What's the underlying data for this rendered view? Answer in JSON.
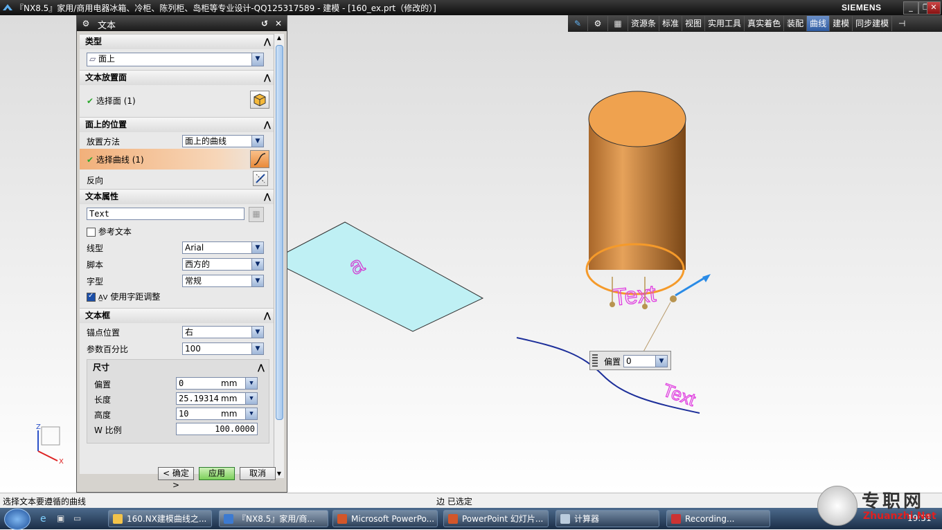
{
  "window": {
    "title": "『NX8.5』家用/商用电器冰箱、冷柜、陈列柜、岛柜等专业设计-QQ125317589 - 建模 - [160_ex.prt（修改的）]",
    "brand": "SIEMENS"
  },
  "toolbar": {
    "tabs": [
      "资源条",
      "标准",
      "视图",
      "实用工具",
      "真实着色",
      "装配",
      "曲线",
      "建模",
      "同步建模"
    ],
    "active": "曲线"
  },
  "dialog": {
    "title": "文本",
    "sections": {
      "type": {
        "header": "类型",
        "value": "面上"
      },
      "placement_face": {
        "header": "文本放置面",
        "select_face": "选择面 (1)"
      },
      "face_position": {
        "header": "面上的位置",
        "method_label": "放置方法",
        "method_value": "面上的曲线",
        "select_curve": "选择曲线 (1)",
        "reverse_label": "反向"
      },
      "text_props": {
        "header": "文本属性",
        "text_value": "Text",
        "ref_text_label": "参考文本",
        "font_label": "线型",
        "font_value": "Arial",
        "script_label": "脚本",
        "script_value": "西方的",
        "style_label": "字型",
        "style_value": "常规",
        "kerning_label": "使用字距调整"
      },
      "text_box": {
        "header": "文本框",
        "anchor_label": "锚点位置",
        "anchor_value": "右",
        "param_label": "参数百分比",
        "param_value": "100",
        "dims_header": "尺寸",
        "offset_label": "偏置",
        "offset_value": "0",
        "length_label": "长度",
        "length_value": "25.19314",
        "height_label": "高度",
        "height_value": "10",
        "unit": "mm",
        "wscale_label": "W 比例",
        "wscale_value": "100.0000"
      }
    },
    "buttons": {
      "ok": "< 确定 >",
      "apply": "应用",
      "cancel": "取消"
    }
  },
  "viewport": {
    "plane_text": "a",
    "cyl_text": "Text",
    "curve_text": "Text",
    "popup_label": "偏置",
    "popup_value": "0",
    "axis_z": "Z",
    "axis_x": "X"
  },
  "status": {
    "left": "选择文本要遵循的曲线",
    "right": "边 已选定"
  },
  "taskbar": {
    "items": [
      "160.NX建模曲线之...",
      "『NX8.5』家用/商...",
      "Microsoft PowerPo...",
      "PowerPoint 幻灯片...",
      "计算器",
      "Recording..."
    ],
    "clock": "19:51"
  },
  "watermark": {
    "text": "专职网",
    "url": "Zhuanzhi.Net"
  }
}
